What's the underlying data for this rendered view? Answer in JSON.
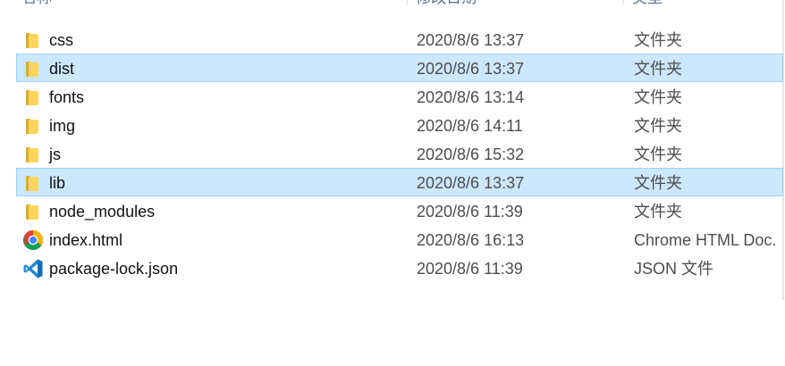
{
  "columns": {
    "name": "名称",
    "date": "修改日期",
    "type": "类型"
  },
  "files": [
    {
      "name": "css",
      "date": "2020/8/6 13:37",
      "type": "文件夹",
      "icon": "folder-icon",
      "selected": false
    },
    {
      "name": "dist",
      "date": "2020/8/6 13:37",
      "type": "文件夹",
      "icon": "folder-icon",
      "selected": true
    },
    {
      "name": "fonts",
      "date": "2020/8/6 13:14",
      "type": "文件夹",
      "icon": "folder-icon",
      "selected": false
    },
    {
      "name": "img",
      "date": "2020/8/6 14:11",
      "type": "文件夹",
      "icon": "folder-icon",
      "selected": false
    },
    {
      "name": "js",
      "date": "2020/8/6 15:32",
      "type": "文件夹",
      "icon": "folder-icon",
      "selected": false
    },
    {
      "name": "lib",
      "date": "2020/8/6 13:37",
      "type": "文件夹",
      "icon": "folder-icon",
      "selected": true
    },
    {
      "name": "node_modules",
      "date": "2020/8/6 11:39",
      "type": "文件夹",
      "icon": "folder-icon",
      "selected": false
    },
    {
      "name": "index.html",
      "date": "2020/8/6 16:13",
      "type": "Chrome HTML Doc.",
      "icon": "chrome-icon",
      "selected": false
    },
    {
      "name": "package-lock.json",
      "date": "2020/8/6 11:39",
      "type": "JSON 文件",
      "icon": "vscode-icon",
      "selected": false
    }
  ],
  "colors": {
    "selection_bg": "#cce8ff",
    "selection_border": "#99d1ff",
    "folder": "#ffd55c",
    "header_text": "#5a6d86"
  }
}
